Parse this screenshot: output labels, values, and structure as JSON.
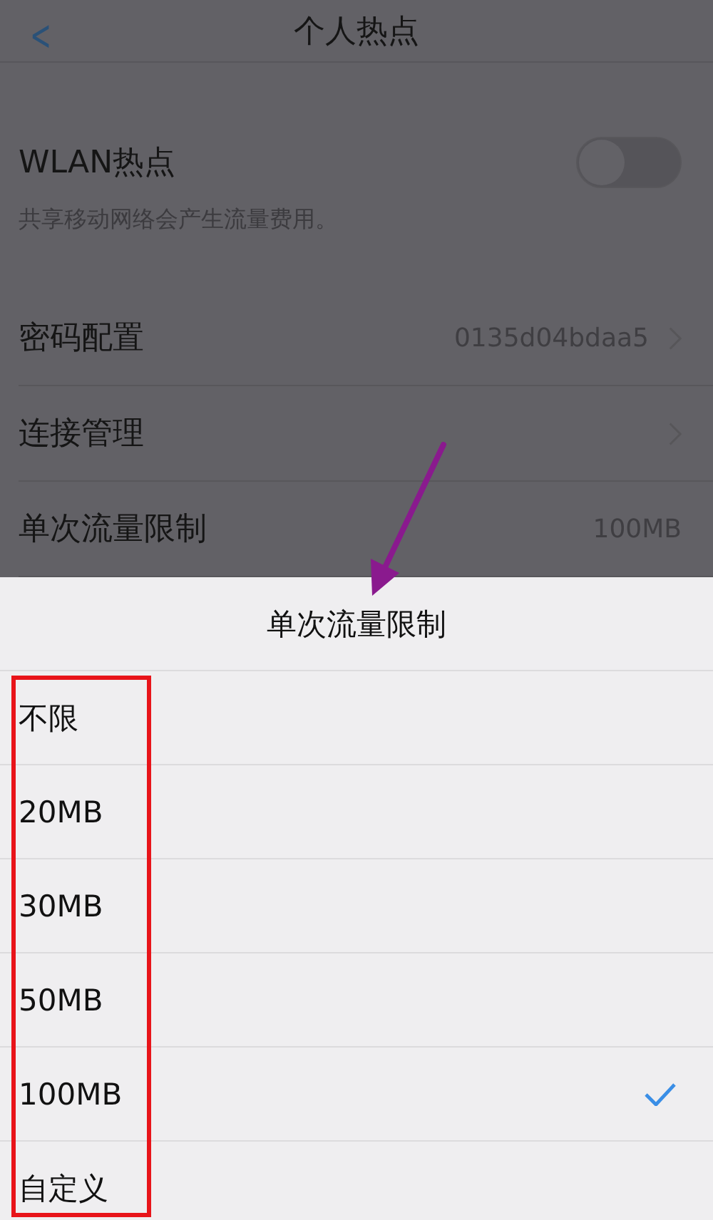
{
  "nav": {
    "back": "<",
    "title": "个人热点"
  },
  "hotspot": {
    "label": "WLAN热点",
    "on": false,
    "note": "共享移动网络会产生流量费用。"
  },
  "rows": [
    {
      "label": "密码配置",
      "value": "0135d04bdaa5",
      "disclosure": true
    },
    {
      "label": "连接管理",
      "disclosure": true
    },
    {
      "label": "单次流量限制",
      "value": "100MB",
      "disclosure": false
    }
  ],
  "sheet": {
    "title": "单次流量限制",
    "options": [
      {
        "label": "不限",
        "selected": false
      },
      {
        "label": "20MB",
        "selected": false
      },
      {
        "label": "30MB",
        "selected": false
      },
      {
        "label": "50MB",
        "selected": false
      },
      {
        "label": "100MB",
        "selected": true
      },
      {
        "label": "自定义",
        "selected": false
      }
    ]
  }
}
